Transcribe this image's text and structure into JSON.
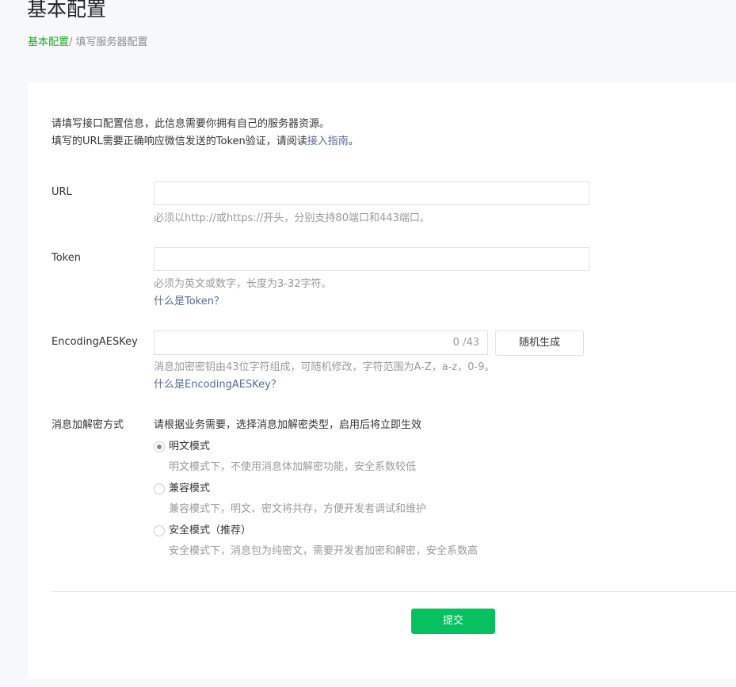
{
  "page": {
    "title": "基本配置"
  },
  "breadcrumb": {
    "link": "基本配置",
    "separator": "/ ",
    "current": "填写服务器配置"
  },
  "intro": {
    "line1": "请填写接口配置信息，此信息需要你拥有自己的服务器资源。",
    "line2_prefix": "填写的URL需要正确响应微信发送的Token验证，请阅读",
    "guide_link": "接入指南",
    "line2_suffix": "。"
  },
  "url": {
    "label": "URL",
    "value": "",
    "hint": "必须以http://或https://开头，分别支持80端口和443端口。"
  },
  "token": {
    "label": "Token",
    "value": "",
    "hint": "必须为英文或数字，长度为3-32字符。",
    "help_link": "什么是Token？"
  },
  "aes": {
    "label": "EncodingAESKey",
    "value": "",
    "counter": "0 /43",
    "random_button": "随机生成",
    "hint": "消息加密密钥由43位字符组成，可随机修改，字符范围为A-Z，a-z，0-9。",
    "help_link": "什么是EncodingAESKey？"
  },
  "encryption": {
    "label": "消息加解密方式",
    "description": "请根据业务需要，选择消息加解密类型，启用后将立即生效",
    "options": [
      {
        "label": "明文模式",
        "desc": "明文模式下，不使用消息体加解密功能，安全系数较低",
        "checked": true
      },
      {
        "label": "兼容模式",
        "desc": "兼容模式下，明文、密文将共存，方便开发者调试和维护",
        "checked": false
      },
      {
        "label": "安全模式（推荐）",
        "desc": "安全模式下，消息包为纯密文，需要开发者加密和解密，安全系数高",
        "checked": false
      }
    ]
  },
  "submit": {
    "label": "提交"
  },
  "colors": {
    "brand_green": "#07c160",
    "link_green": "#1aad19",
    "link_blue": "#576b95"
  }
}
